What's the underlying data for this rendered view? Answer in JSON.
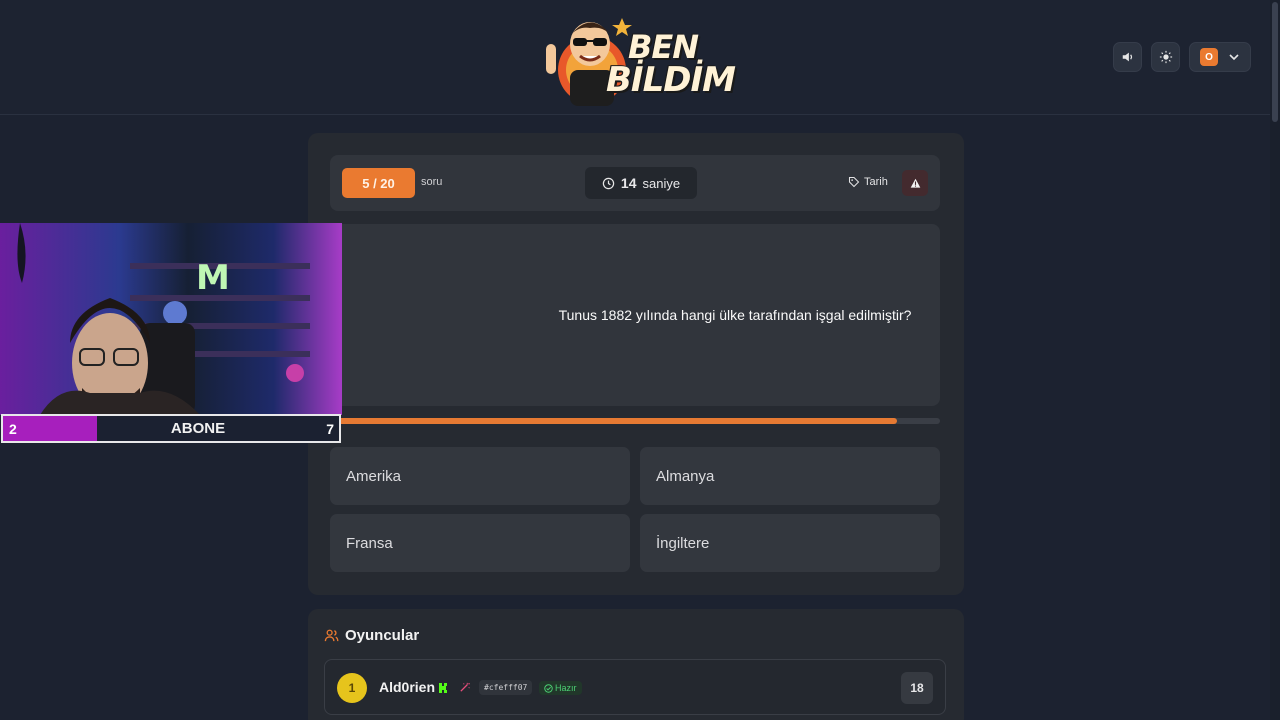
{
  "brand": {
    "logo_line1": "BEN",
    "logo_line2": "BİLDİM",
    "accent_color": "#ea7a30"
  },
  "header_controls": {
    "volume_icon": "speaker-icon",
    "theme_icon": "sun-icon",
    "user_initial": "O",
    "dropdown_icon": "chevron-down-icon"
  },
  "quiz": {
    "counter": "5 / 20",
    "counter_suffix": "soru",
    "timer_value": "14",
    "timer_unit": "saniye",
    "category": "Tarih",
    "question": "Tunus 1882 yılında hangi ülke tarafından işgal edilmiştir?",
    "progress_fraction": 0.93,
    "answers": [
      "Amerika",
      "Almanya",
      "Fransa",
      "İngiltere"
    ]
  },
  "players": {
    "title": "Oyuncular",
    "list": [
      {
        "rank": "1",
        "name": "Ald0rien",
        "color_code": "#cfefff07",
        "status": "Hazır",
        "score": "18"
      }
    ]
  },
  "stream_overlay": {
    "left_count": "2",
    "label": "ABONE",
    "right_count": "7"
  }
}
